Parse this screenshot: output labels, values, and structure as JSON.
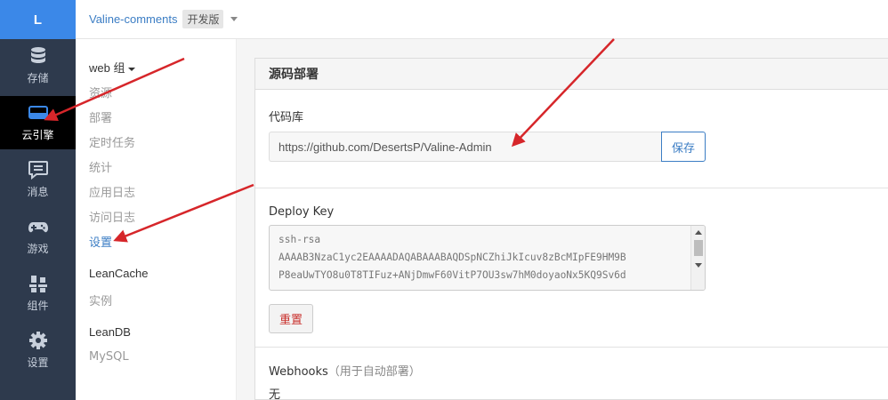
{
  "rail": {
    "logo": "L",
    "items": [
      {
        "label": "存储",
        "icon": "database-icon"
      },
      {
        "label": "云引擎",
        "icon": "server-icon"
      },
      {
        "label": "消息",
        "icon": "message-icon"
      },
      {
        "label": "游戏",
        "icon": "gamepad-icon"
      },
      {
        "label": "组件",
        "icon": "components-icon"
      },
      {
        "label": "设置",
        "icon": "gear-icon"
      }
    ],
    "active_index": 1
  },
  "topbar": {
    "app_name": "Valine-comments",
    "env_badge": "开发版"
  },
  "subnav": {
    "group1": "web 组",
    "group1_items": [
      "资源",
      "部署",
      "定时任务",
      "统计",
      "应用日志",
      "访问日志",
      "设置"
    ],
    "active_item": "设置",
    "group2": "LeanCache",
    "group2_items": [
      "实例"
    ],
    "group3": "LeanDB",
    "group3_items": [
      "MySQL"
    ]
  },
  "panel": {
    "title": "源码部署",
    "repo": {
      "label": "代码库",
      "value": "https://github.com/DesertsP/Valine-Admin",
      "save_button": "保存"
    },
    "deploy_key": {
      "label": "Deploy Key",
      "lines": [
        "ssh-rsa",
        "AAAAB3NzaC1yc2EAAAADAQABAAABAQDSpNCZhiJkIcuv8zBcMIpFE9HM9B",
        "P8eaUwTYO8u0T8TIFuz+ANjDmwF60VitP7OU3sw7hM0doyaoNx5KQ9Sv6d"
      ],
      "reset_button": "重置"
    },
    "webhooks": {
      "label": "Webhooks",
      "note": "（用于自动部署）",
      "value": "无"
    }
  },
  "colors": {
    "rail_bg": "#2e3a4d",
    "logo_bg": "#3b88e8",
    "link_blue": "#3b7dc4",
    "danger_red": "#c9302c",
    "annotation_red": "#d6262a"
  }
}
